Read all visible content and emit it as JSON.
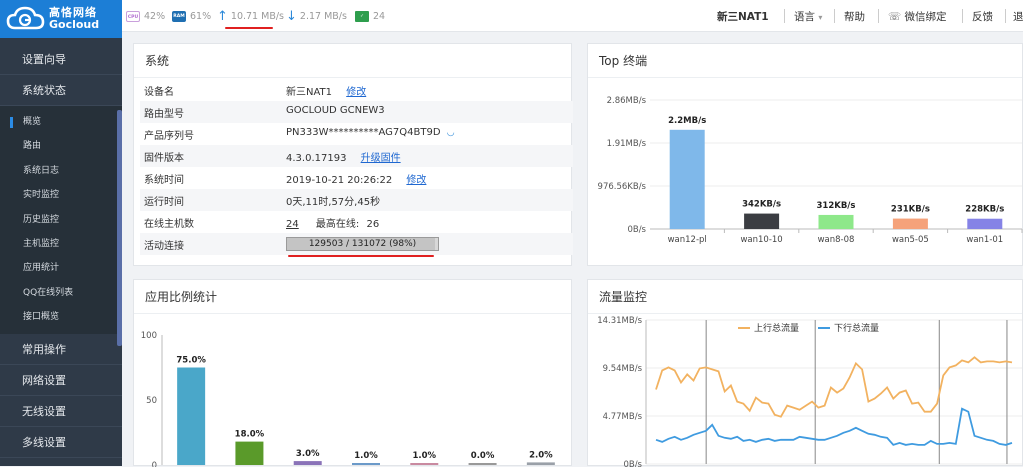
{
  "brand": {
    "cn": "高恪网络",
    "en": "Gocloud"
  },
  "sidebar": {
    "groups_top": [
      "设置向导",
      "系统状态"
    ],
    "subs": [
      "概览",
      "路由",
      "系统日志",
      "实时监控",
      "历史监控",
      "主机监控",
      "应用统计",
      "QQ在线列表",
      "接口概览"
    ],
    "groups_bottom": [
      "常用操作",
      "网络设置",
      "无线设置",
      "多线设置"
    ]
  },
  "topbar": {
    "cpu": "42%",
    "ram": "61%",
    "up_speed": "10.71 MB/s",
    "down_speed": "2.17 MB/s",
    "conn_count": "24",
    "device": "新三NAT1",
    "lang": "语言",
    "help": "帮助",
    "wechat": "微信绑定",
    "feedback": "反馈",
    "logout": "退"
  },
  "system_panel": {
    "title": "系统",
    "rows": [
      {
        "key": "设备名",
        "value": "新三NAT1",
        "link": "修改"
      },
      {
        "key": "路由型号",
        "value": "GOCLOUD GCNEW3"
      },
      {
        "key": "产品序列号",
        "value": "PN333W**********AG7Q4BT9D"
      },
      {
        "key": "固件版本",
        "value": "4.3.0.17193",
        "link": "升级固件"
      },
      {
        "key": "系统时间",
        "value": "2019-10-21 20:26:22",
        "link": "修改"
      },
      {
        "key": "运行时间",
        "value": "0天,11时,57分,45秒"
      },
      {
        "key": "在线主机数",
        "value": "24",
        "extra_label": "最高在线:",
        "extra_value": "26"
      },
      {
        "key": "活动连接",
        "progress_text": "129503 / 131072 (98%)",
        "progress": 0.98
      }
    ]
  },
  "top_panel": {
    "title": "Top 终端"
  },
  "app_panel": {
    "title": "应用比例统计"
  },
  "flow_panel": {
    "title": "流量监控"
  },
  "chart_data": [
    {
      "type": "bar",
      "title": "Top 终端",
      "categories": [
        "wan12-pl",
        "wan10-10",
        "wan8-08",
        "wan5-05",
        "wan1-01"
      ],
      "values": [
        2.2,
        0.342,
        0.312,
        0.231,
        0.228
      ],
      "unit": "MB/s",
      "data_labels": [
        "2.2MB/s",
        "342KB/s",
        "312KB/s",
        "231KB/s",
        "228KB/s"
      ],
      "colors": [
        "#7fb8ea",
        "#3b3d42",
        "#8ee88a",
        "#f5a27a",
        "#8583e6"
      ],
      "yticks": [
        "0B/s",
        "976.56KB/s",
        "1.91MB/s",
        "2.86MB/s"
      ],
      "ytick_values": [
        0,
        0.9537,
        1.907,
        2.861
      ],
      "ylim": [
        0,
        2.861
      ]
    },
    {
      "type": "bar",
      "title": "应用比例统计",
      "values": [
        75.0,
        18.0,
        3.0,
        1.0,
        1.0,
        0.0,
        2.0
      ],
      "data_labels": [
        "75.0%",
        "18.0%",
        "3.0%",
        "1.0%",
        "1.0%",
        "0.0%",
        "2.0%"
      ],
      "colors": [
        "#4aa7c9",
        "#5a9a2a",
        "#8a73b8",
        "#6b9ac9",
        "#c98aa0",
        "#999999",
        "#9aa0a8"
      ],
      "yticks": [
        "0",
        "50",
        "100"
      ],
      "ytick_values": [
        0,
        50,
        100
      ],
      "ylim": [
        0,
        100
      ]
    },
    {
      "type": "line",
      "title": "流量监控",
      "yticks": [
        "0B/s",
        "4.77MB/s",
        "9.54MB/s",
        "14.31MB/s"
      ],
      "ytick_values": [
        0,
        4.77,
        9.54,
        14.31
      ],
      "ylim": [
        0,
        14.31
      ],
      "series": [
        {
          "name": "上行总流量",
          "color": "#f2b260",
          "values": [
            7.4,
            9.3,
            9.6,
            9.3,
            8.1,
            8.9,
            8.3,
            9.5,
            9.6,
            9.4,
            9.2,
            7.2,
            7.8,
            6.2,
            6.0,
            5.3,
            6.6,
            6.1,
            6.0,
            4.9,
            4.7,
            5.8,
            5.6,
            5.4,
            5.8,
            6.2,
            5.6,
            5.8,
            7.6,
            7.1,
            7.5,
            8.6,
            10.0,
            9.4,
            6.2,
            6.5,
            7.0,
            7.6,
            6.5,
            7.1,
            7.3,
            6.0,
            6.1,
            5.2,
            5.2,
            6.0,
            8.8,
            9.6,
            9.8,
            10.3,
            10.1,
            10.6,
            10.1,
            10.2,
            10.2,
            10.1,
            10.2,
            10.1
          ]
        },
        {
          "name": "下行总流量",
          "color": "#3f9be0",
          "values": [
            2.4,
            2.2,
            2.5,
            2.7,
            2.4,
            2.6,
            2.9,
            3.1,
            3.3,
            3.9,
            2.8,
            2.6,
            2.5,
            2.7,
            2.3,
            2.4,
            2.2,
            2.4,
            2.5,
            2.3,
            2.4,
            2.4,
            2.4,
            2.7,
            2.6,
            2.5,
            2.4,
            2.4,
            2.6,
            2.8,
            3.1,
            3.3,
            3.6,
            3.3,
            3.0,
            2.9,
            2.7,
            2.6,
            1.9,
            2.1,
            1.9,
            2.0,
            1.9,
            1.9,
            2.3,
            2.0,
            2.0,
            2.1,
            2.0,
            5.5,
            5.2,
            2.8,
            2.6,
            2.4,
            2.3,
            2.0,
            1.9,
            2.1
          ]
        }
      ]
    }
  ]
}
